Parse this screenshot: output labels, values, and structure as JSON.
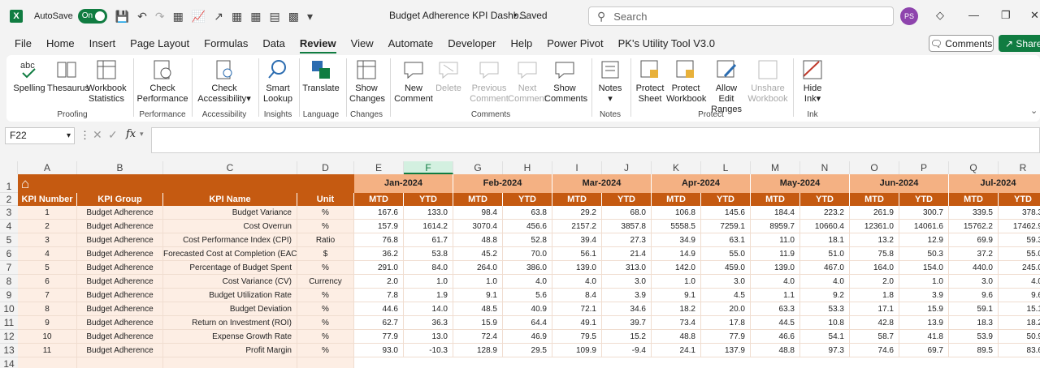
{
  "titlebar": {
    "autosave_label": "AutoSave",
    "autosave_state": "On",
    "doc_title": "Budget Adherence KPI Dashb...",
    "saved_status": "• Saved",
    "search_placeholder": "Search",
    "avatar_initials": "PS"
  },
  "menu": {
    "tabs": [
      "File",
      "Home",
      "Insert",
      "Page Layout",
      "Formulas",
      "Data",
      "Review",
      "View",
      "Automate",
      "Developer",
      "Help",
      "Power Pivot",
      "PK's Utility Tool V3.0"
    ],
    "active": "Review",
    "comments_label": "Comments",
    "share_label": "Share"
  },
  "ribbon": {
    "spelling": "Spelling",
    "thesaurus": "Thesaurus",
    "workbook_statistics_1": "Workbook",
    "workbook_statistics_2": "Statistics",
    "proofing": "Proofing",
    "check_performance_1": "Check",
    "check_performance_2": "Performance",
    "performance": "Performance",
    "check_accessibility_1": "Check",
    "check_accessibility_2": "Accessibility",
    "accessibility": "Accessibility",
    "smart_lookup_1": "Smart",
    "smart_lookup_2": "Lookup",
    "insights": "Insights",
    "translate": "Translate",
    "language": "Language",
    "show_changes_1": "Show",
    "show_changes_2": "Changes",
    "changes": "Changes",
    "new_comment_1": "New",
    "new_comment_2": "Comment",
    "delete": "Delete",
    "previous_comment_1": "Previous",
    "previous_comment_2": "Comment",
    "next_comment_1": "Next",
    "next_comment_2": "Comment",
    "show_comments_1": "Show",
    "show_comments_2": "Comments",
    "comments": "Comments",
    "notes_btn": "Notes",
    "notes": "Notes",
    "protect_sheet_1": "Protect",
    "protect_sheet_2": "Sheet",
    "protect_workbook_1": "Protect",
    "protect_workbook_2": "Workbook",
    "allow_edit_1": "Allow Edit",
    "allow_edit_2": "Ranges",
    "unshare_1": "Unshare",
    "unshare_2": "Workbook",
    "protect": "Protect",
    "hide_ink_1": "Hide",
    "hide_ink_2": "Ink",
    "ink": "Ink"
  },
  "formula_bar": {
    "name_box": "F22",
    "fx": "fx",
    "value": ""
  },
  "sheet": {
    "columns": [
      "A",
      "B",
      "C",
      "D",
      "E",
      "F",
      "G",
      "H",
      "I",
      "J",
      "K",
      "L",
      "M",
      "N",
      "O",
      "P",
      "Q",
      "R"
    ],
    "row_numbers": [
      "1",
      "2",
      "3",
      "4",
      "5",
      "6",
      "7",
      "8",
      "9",
      "10",
      "11",
      "12",
      "13",
      "14"
    ],
    "headers": {
      "kpi_number": "KPI Number",
      "kpi_group": "KPI Group",
      "kpi_name": "KPI Name",
      "unit": "Unit",
      "mtd": "MTD",
      "ytd": "YTD"
    },
    "months": [
      "Jan-2024",
      "Feb-2024",
      "Mar-2024",
      "Apr-2024",
      "May-2024",
      "Jun-2024",
      "Jul-2024"
    ],
    "rows": [
      {
        "num": "1",
        "group": "Budget Adherence",
        "name": "Budget Variance",
        "unit": "%",
        "vals": [
          "167.6",
          "133.0",
          "98.4",
          "63.8",
          "29.2",
          "68.0",
          "106.8",
          "145.6",
          "184.4",
          "223.2",
          "261.9",
          "300.7",
          "339.5",
          "378.3"
        ]
      },
      {
        "num": "2",
        "group": "Budget Adherence",
        "name": "Cost Overrun",
        "unit": "%",
        "vals": [
          "157.9",
          "1614.2",
          "3070.4",
          "456.6",
          "2157.2",
          "3857.8",
          "5558.5",
          "7259.1",
          "8959.7",
          "10660.4",
          "12361.0",
          "14061.6",
          "15762.2",
          "17462.9"
        ]
      },
      {
        "num": "3",
        "group": "Budget Adherence",
        "name": "Cost Performance Index (CPI)",
        "unit": "Ratio",
        "vals": [
          "76.8",
          "61.7",
          "48.8",
          "52.8",
          "39.4",
          "27.3",
          "34.9",
          "63.1",
          "11.0",
          "18.1",
          "13.2",
          "12.9",
          "69.9",
          "59.3"
        ]
      },
      {
        "num": "4",
        "group": "Budget Adherence",
        "name": "Forecasted Cost at Completion (EAC)",
        "unit": "$",
        "vals": [
          "36.2",
          "53.8",
          "45.2",
          "70.0",
          "56.1",
          "21.4",
          "14.9",
          "55.0",
          "11.9",
          "51.0",
          "75.8",
          "50.3",
          "37.2",
          "55.0"
        ]
      },
      {
        "num": "5",
        "group": "Budget Adherence",
        "name": "Percentage of Budget Spent",
        "unit": "%",
        "vals": [
          "291.0",
          "84.0",
          "264.0",
          "386.0",
          "139.0",
          "313.0",
          "142.0",
          "459.0",
          "139.0",
          "467.0",
          "164.0",
          "154.0",
          "440.0",
          "245.0"
        ]
      },
      {
        "num": "6",
        "group": "Budget Adherence",
        "name": "Cost Variance (CV)",
        "unit": "Currency",
        "vals": [
          "2.0",
          "1.0",
          "1.0",
          "4.0",
          "4.0",
          "3.0",
          "1.0",
          "3.0",
          "4.0",
          "4.0",
          "2.0",
          "1.0",
          "3.0",
          "4.0"
        ]
      },
      {
        "num": "7",
        "group": "Budget Adherence",
        "name": "Budget Utilization Rate",
        "unit": "%",
        "vals": [
          "7.8",
          "1.9",
          "9.1",
          "5.6",
          "8.4",
          "3.9",
          "9.1",
          "4.5",
          "1.1",
          "9.2",
          "1.8",
          "3.9",
          "9.6",
          "9.6"
        ]
      },
      {
        "num": "8",
        "group": "Budget Adherence",
        "name": "Budget Deviation",
        "unit": "%",
        "vals": [
          "44.6",
          "14.0",
          "48.5",
          "40.9",
          "72.1",
          "34.6",
          "18.2",
          "20.0",
          "63.3",
          "53.3",
          "17.1",
          "15.9",
          "59.1",
          "15.1"
        ]
      },
      {
        "num": "9",
        "group": "Budget Adherence",
        "name": "Return on Investment (ROI)",
        "unit": "%",
        "vals": [
          "62.7",
          "36.3",
          "15.9",
          "64.4",
          "49.1",
          "39.7",
          "73.4",
          "17.8",
          "44.5",
          "10.8",
          "42.8",
          "13.9",
          "18.3",
          "18.2"
        ]
      },
      {
        "num": "10",
        "group": "Budget Adherence",
        "name": "Expense Growth Rate",
        "unit": "%",
        "vals": [
          "77.9",
          "13.0",
          "72.4",
          "46.9",
          "79.5",
          "15.2",
          "48.8",
          "77.9",
          "46.6",
          "54.1",
          "58.7",
          "41.8",
          "53.9",
          "50.9"
        ]
      },
      {
        "num": "11",
        "group": "Budget Adherence",
        "name": "Profit Margin",
        "unit": "%",
        "vals": [
          "93.0",
          "-10.3",
          "128.9",
          "29.5",
          "109.9",
          "-9.4",
          "24.1",
          "137.9",
          "48.8",
          "97.3",
          "74.6",
          "69.7",
          "89.5",
          "83.6"
        ]
      }
    ]
  }
}
